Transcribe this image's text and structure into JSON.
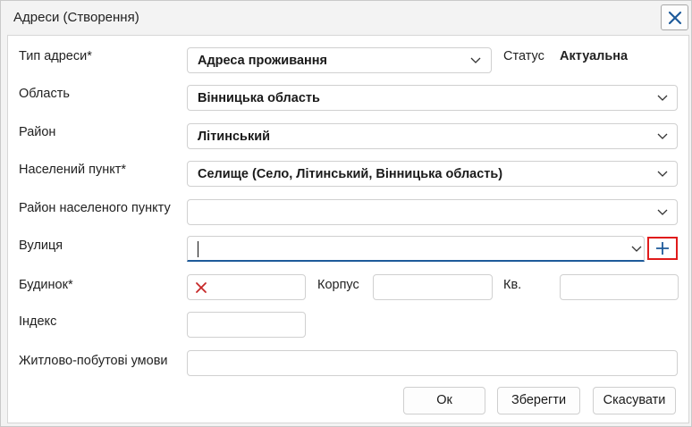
{
  "window": {
    "title": "Адреси (Створення)"
  },
  "form": {
    "address_type": {
      "label": "Тип адреси*",
      "value": "Адреса проживання"
    },
    "status": {
      "label": "Статус",
      "value": "Актуальна"
    },
    "region": {
      "label": "Область",
      "value": "Вінницька область"
    },
    "district": {
      "label": "Район",
      "value": "Літинський"
    },
    "settlement": {
      "label": "Населений пункт*",
      "value": "Селище (Село, Літинський, Вінницька область)"
    },
    "settlement_district": {
      "label": "Район населеного пункту",
      "value": ""
    },
    "street": {
      "label": "Вулиця",
      "value": ""
    },
    "building": {
      "label": "Будинок*",
      "value": ""
    },
    "block": {
      "label": "Корпус",
      "value": ""
    },
    "apartment": {
      "label": "Кв.",
      "value": ""
    },
    "postcode": {
      "label": "Індекс",
      "value": ""
    },
    "living_conditions": {
      "label": "Житлово-побутові умови",
      "value": ""
    }
  },
  "buttons": {
    "ok": "Ок",
    "save": "Зберегти",
    "cancel": "Скасувати"
  },
  "colors": {
    "accent": "#1d5a9a",
    "highlight": "#e01b1b",
    "error": "#c62828"
  },
  "icons": {
    "close": "close-icon",
    "chevron": "chevron-down-icon",
    "add": "plus-icon",
    "error": "error-x-icon"
  }
}
